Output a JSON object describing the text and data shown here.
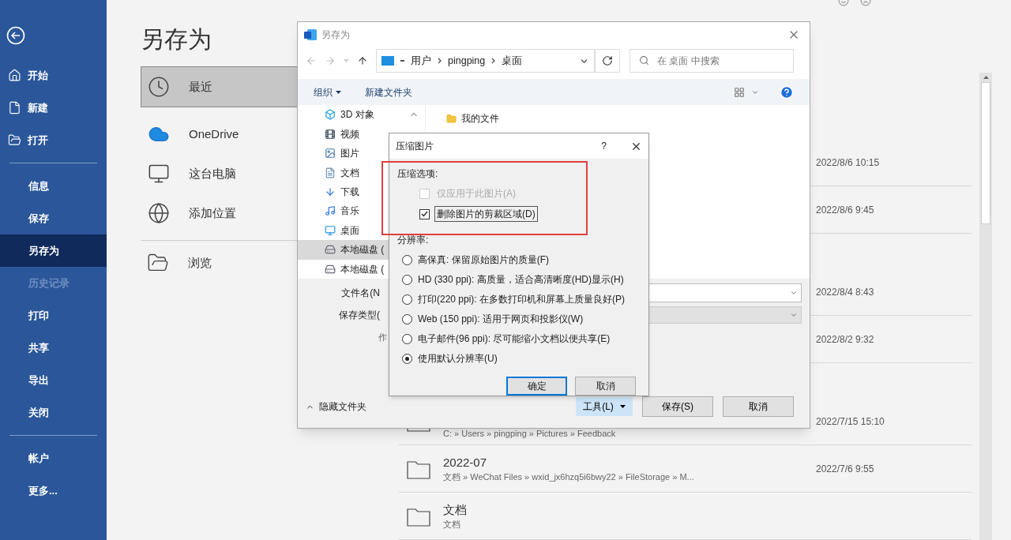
{
  "sidebar": {
    "groups": [
      [
        {
          "label": "开始",
          "selected": false,
          "disabled": false
        },
        {
          "label": "新建",
          "selected": false,
          "disabled": false
        },
        {
          "label": "打开",
          "selected": false,
          "disabled": false
        }
      ],
      [
        {
          "label": "信息",
          "selected": false,
          "disabled": false
        },
        {
          "label": "保存",
          "selected": false,
          "disabled": false
        },
        {
          "label": "另存为",
          "selected": true,
          "disabled": false
        },
        {
          "label": "历史记录",
          "selected": false,
          "disabled": true
        },
        {
          "label": "打印",
          "selected": false,
          "disabled": false
        },
        {
          "label": "共享",
          "selected": false,
          "disabled": false
        },
        {
          "label": "导出",
          "selected": false,
          "disabled": false
        },
        {
          "label": "关闭",
          "selected": false,
          "disabled": false
        }
      ],
      [
        {
          "label": "帐户",
          "selected": false,
          "disabled": false
        },
        {
          "label": "更多...",
          "selected": false,
          "disabled": false
        }
      ]
    ]
  },
  "page_title": "另存为",
  "places": [
    {
      "label": "最近",
      "selected": true
    },
    {
      "label": "OneDrive",
      "selected": false
    },
    {
      "label": "这台电脑",
      "selected": false
    },
    {
      "label": "添加位置",
      "selected": false
    }
  ],
  "browse": {
    "label": "浏览"
  },
  "recent": {
    "groups": [
      {
        "rows": [
          {
            "date": "2022/8/6 10:15"
          },
          {
            "date": "2022/8/6 9:45"
          }
        ]
      },
      {
        "rows": [
          {
            "date": "2022/8/4 8:43"
          },
          {
            "date": "2022/8/2 9:32"
          }
        ]
      },
      {
        "rows": [
          {
            "path": "C: » Users » pingping » Pictures » Feedback",
            "date": "2022/7/15 15:10"
          },
          {
            "name": "2022-07",
            "path": "文档 » WeChat Files » wxid_jx6hzq5i6bwy22 » FileStorage » M...",
            "date": "2022/7/6 9:55"
          },
          {
            "name": "文档",
            "path": "文档"
          }
        ]
      }
    ]
  },
  "save_dialog": {
    "title": "另存为",
    "address": [
      "用户",
      "pingping",
      "桌面"
    ],
    "search": {
      "placeholder": "在 桌面 中搜索"
    },
    "organize": "组织",
    "new_folder": "新建文件夹",
    "nav": [
      {
        "label": "3D 对象",
        "selected": false
      },
      {
        "label": "视频",
        "selected": false
      },
      {
        "label": "图片",
        "selected": false
      },
      {
        "label": "文档",
        "selected": false
      },
      {
        "label": "下载",
        "selected": false
      },
      {
        "label": "音乐",
        "selected": false
      },
      {
        "label": "桌面",
        "selected": false
      },
      {
        "label": "本地磁盘 (",
        "selected": true
      },
      {
        "label": "本地磁盘 (",
        "selected": false
      }
    ],
    "files": [
      {
        "name": "我的文件"
      }
    ],
    "filename_label": "文件名(N",
    "type_label": "保存类型(",
    "author_label": "作",
    "hide_folders": "隐藏文件夹",
    "tools": "工具(L)",
    "save": "保存(S)",
    "cancel": "取消"
  },
  "compress_dialog": {
    "title": "压缩图片",
    "help": "?",
    "options_heading": "压缩选项:",
    "checkboxes": [
      {
        "label": "仅应用于此图片(A)",
        "checked": false,
        "disabled": true,
        "focused": false
      },
      {
        "label": "删除图片的剪裁区域(D)",
        "checked": true,
        "disabled": false,
        "focused": true
      }
    ],
    "resolution_heading": "分辨率:",
    "radios": [
      {
        "label": "高保真: 保留原始图片的质量(F)",
        "selected": false
      },
      {
        "label": "HD (330 ppi): 高质量，适合高清晰度(HD)显示(H)",
        "selected": false
      },
      {
        "label": "打印(220 ppi): 在多数打印机和屏幕上质量良好(P)",
        "selected": false
      },
      {
        "label": "Web (150 ppi): 适用于网页和投影仪(W)",
        "selected": false
      },
      {
        "label": "电子邮件(96 ppi): 尽可能缩小文档以便共享(E)",
        "selected": false
      },
      {
        "label": "使用默认分辨率(U)",
        "selected": true
      }
    ],
    "ok": "确定",
    "cancel": "取消"
  }
}
